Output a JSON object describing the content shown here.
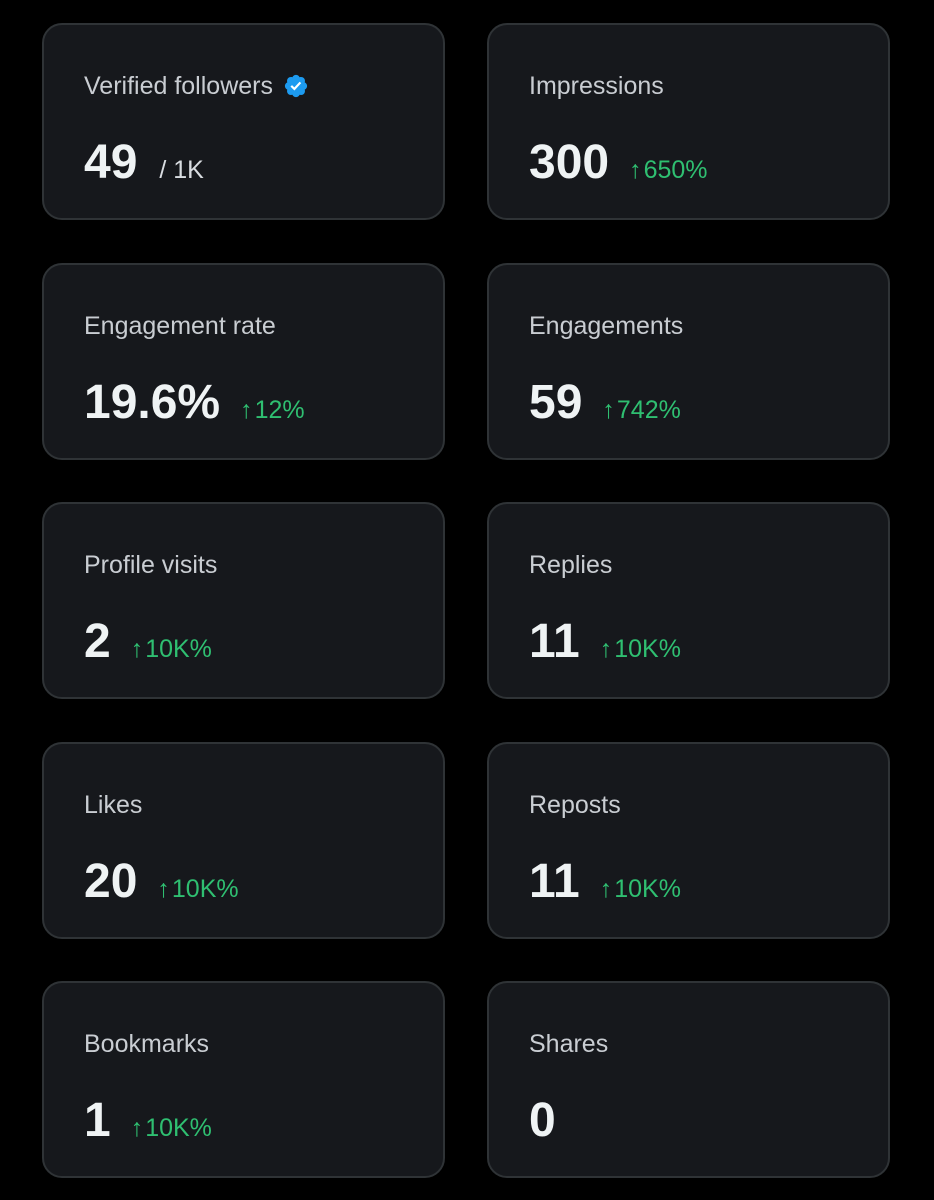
{
  "colors": {
    "background": "#000000",
    "card_background": "#16181c",
    "card_border": "#2f3336",
    "positive": "#2fbf71",
    "verified_badge": "#1d9bf0"
  },
  "cards": [
    {
      "label": "Verified followers",
      "value": "49",
      "suffix": "/ 1K",
      "icon": "verified-badge-icon"
    },
    {
      "label": "Impressions",
      "value": "300",
      "change": "650%",
      "change_arrow": "↑"
    },
    {
      "label": "Engagement rate",
      "value": "19.6%",
      "change": "12%",
      "change_arrow": "↑"
    },
    {
      "label": "Engagements",
      "value": "59",
      "change": "742%",
      "change_arrow": "↑"
    },
    {
      "label": "Profile visits",
      "value": "2",
      "change": "10K%",
      "change_arrow": "↑"
    },
    {
      "label": "Replies",
      "value": "11",
      "change": "10K%",
      "change_arrow": "↑"
    },
    {
      "label": "Likes",
      "value": "20",
      "change": "10K%",
      "change_arrow": "↑"
    },
    {
      "label": "Reposts",
      "value": "11",
      "change": "10K%",
      "change_arrow": "↑"
    },
    {
      "label": "Bookmarks",
      "value": "1",
      "change": "10K%",
      "change_arrow": "↑"
    },
    {
      "label": "Shares",
      "value": "0"
    }
  ]
}
